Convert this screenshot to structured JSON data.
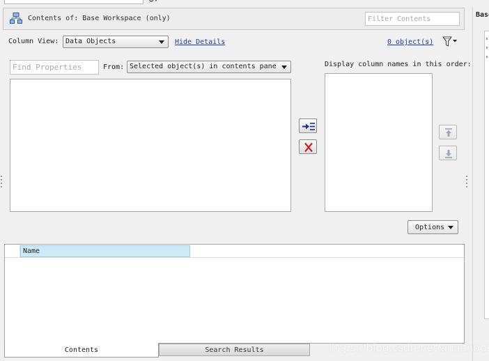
{
  "workspace": {
    "title": "Contents of: Base Workspace (only)",
    "filter_placeholder": "Filter Contents"
  },
  "column_view": {
    "label": "Column View:",
    "selected": "Data Objects",
    "hide_details": "Hide Details",
    "object_count": "0 object(s)"
  },
  "properties": {
    "find_placeholder": "Find Properties",
    "from_label": "From:",
    "from_selected": "Selected object(s) in contents pane",
    "display_label": "Display column names in this order:"
  },
  "buttons": {
    "options": "Options"
  },
  "table": {
    "columns": [
      "Name"
    ]
  },
  "tabs": [
    {
      "label": "Contents",
      "active": true
    },
    {
      "label": "Search Results",
      "active": false
    }
  ],
  "right_panel": {
    "tab_label": "Base"
  },
  "watermark": "https://blog.csdn.net/annanbest",
  "icons": {
    "workspace": "workspace-icon",
    "filter": "filter-funnel-icon",
    "add": "add-column-icon",
    "remove": "remove-column-icon",
    "up": "move-up-icon",
    "down": "move-down-icon"
  },
  "colors": {
    "remove_x": "#d22020",
    "add_arrow": "#1b2f8f",
    "column_header_bg": "#cfe9f7",
    "link": "#1a3ea6"
  }
}
